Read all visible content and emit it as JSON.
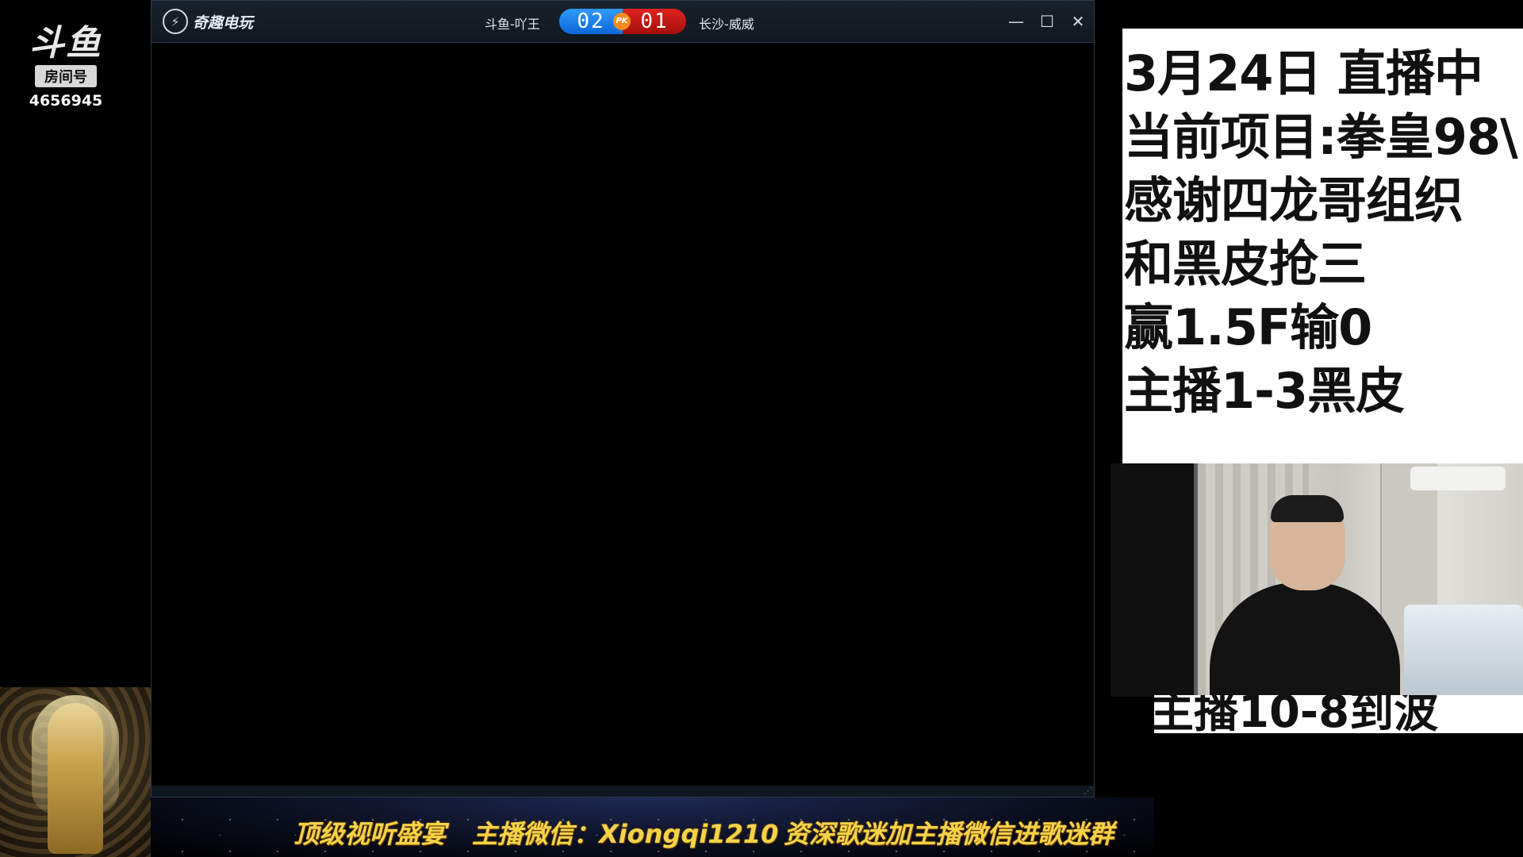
{
  "overlay": {
    "logo_text": "斗鱼",
    "room_tag": "房间号",
    "room_number": "4656945"
  },
  "game_window": {
    "app_name": "奇趣电玩",
    "player_left": "斗鱼-吖王",
    "score_left": "02",
    "pk_label": "PK",
    "score_right": "01",
    "player_right": "长沙-威威",
    "controls": {
      "minimize": "—",
      "maximize": "☐",
      "close": "✕"
    },
    "resize_grip": "⋰",
    "colors": {
      "score_left_bg": "#1a7ff0",
      "score_right_bg": "#c4151a",
      "pk_bg": "#f58a1f"
    }
  },
  "info_panel": {
    "lines": [
      "3月24日 直播中",
      "当前项目:拳皇98\\",
      "感谢四龙哥组织",
      "和黑皮抢三",
      "赢1.5F输0",
      "主播1-3黑皮"
    ],
    "partial_line": "主播10-8到波"
  },
  "banner": {
    "text1": "顶级视听盛宴",
    "text2": "主播微信：Xiongqi1210",
    "text3": "资深歌迷加主播微信进歌迷群",
    "color": "#f4d34a"
  }
}
